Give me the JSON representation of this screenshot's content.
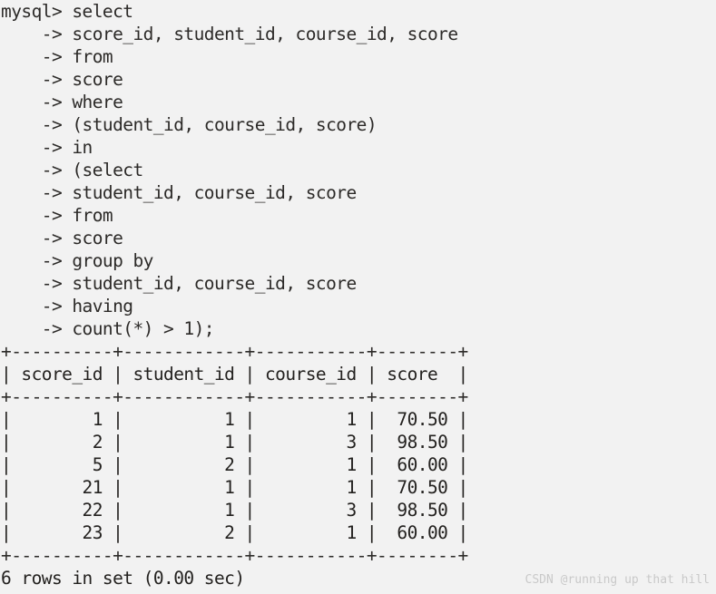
{
  "terminal": {
    "prompt": "mysql>",
    "continuation": "->",
    "query_lines": [
      "mysql> select",
      "    -> score_id, student_id, course_id, score",
      "    -> from",
      "    -> score",
      "    -> where",
      "    -> (student_id, course_id, score)",
      "    -> in",
      "    -> (select",
      "    -> student_id, course_id, score",
      "    -> from",
      "    -> score",
      "    -> group by",
      "    -> student_id, course_id, score",
      "    -> having",
      "    -> count(*) > 1);"
    ],
    "sql_statement": "select score_id, student_id, course_id, score from score where (student_id, course_id, score) in (select student_id, course_id, score from score group by student_id, course_id, score having count(*) > 1);",
    "result_table": {
      "top_border": "+----------+------------+-----------+--------+",
      "header_line": "| score_id | student_id | course_id | score  |",
      "middle_border": "+----------+------------+-----------+--------+",
      "bottom_border": "+----------+------------+-----------+--------+",
      "columns": [
        "score_id",
        "student_id",
        "course_id",
        "score"
      ],
      "rows": [
        {
          "score_id": "1",
          "student_id": "1",
          "course_id": "1",
          "score": "70.50",
          "line": "|        1 |          1 |         1 |  70.50 |"
        },
        {
          "score_id": "2",
          "student_id": "1",
          "course_id": "3",
          "score": "98.50",
          "line": "|        2 |          1 |         3 |  98.50 |"
        },
        {
          "score_id": "5",
          "student_id": "2",
          "course_id": "1",
          "score": "60.00",
          "line": "|        5 |          2 |         1 |  60.00 |"
        },
        {
          "score_id": "21",
          "student_id": "1",
          "course_id": "1",
          "score": "70.50",
          "line": "|       21 |          1 |         1 |  70.50 |"
        },
        {
          "score_id": "22",
          "student_id": "1",
          "course_id": "3",
          "score": "98.50",
          "line": "|       22 |          1 |         3 |  98.50 |"
        },
        {
          "score_id": "23",
          "student_id": "2",
          "course_id": "1",
          "score": "60.00",
          "line": "|       23 |          2 |         1 |  60.00 |"
        }
      ]
    },
    "status_line": "6 rows in set (0.00 sec)",
    "row_count": "6",
    "elapsed": "0.00 sec"
  },
  "watermark": {
    "text": "CSDN @running up that hill"
  },
  "colors": {
    "background": "#f2f2f2",
    "text": "#23211f",
    "watermark": "#c9c9c9"
  }
}
